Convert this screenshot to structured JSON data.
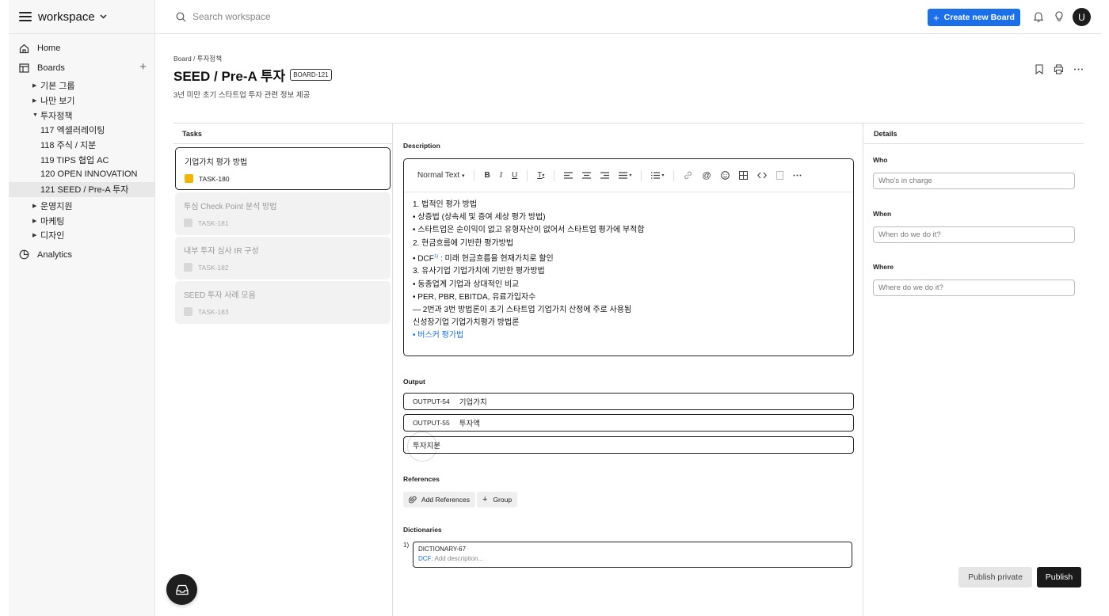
{
  "app": {
    "name": "workspace"
  },
  "topbar": {
    "search_placeholder": "Search workspace",
    "create_button": "Create new Board",
    "create_icon": "+",
    "avatar_initial": "U"
  },
  "sidebar": {
    "home": "Home",
    "boards": "Boards",
    "analytics": "Analytics",
    "tree": [
      {
        "label": "기본 그룹"
      },
      {
        "label": "나만 보기"
      },
      {
        "label": "투자정책"
      },
      {
        "label": "117 엑셀러레이팅"
      },
      {
        "label": "118 주식 / 지분"
      },
      {
        "label": "119 TIPS 협업 AC"
      },
      {
        "label": "120 OPEN INNOVATION"
      },
      {
        "label": "121 SEED / Pre-A 투자"
      },
      {
        "label": "운영지원"
      },
      {
        "label": "마케팅"
      },
      {
        "label": "디자인"
      }
    ]
  },
  "page": {
    "breadcrumb": "Board / 투자정책",
    "title": "SEED / Pre-A 투자",
    "badge": "BOARD-121",
    "subtitle": "3년 미만 초기 스타트업 투자 관련 정보 제공"
  },
  "tasks": {
    "header": "Tasks",
    "items": [
      {
        "name": "기업가치 평가 방법",
        "id": "TASK-180"
      },
      {
        "name": "투심 Check Point 분석 방법",
        "id": "TASK-181"
      },
      {
        "name": "내부 투자 심사 IR 구성",
        "id": "TASK-182"
      },
      {
        "name": "SEED 투자 사례 모음",
        "id": "TASK-183"
      }
    ]
  },
  "description": {
    "label": "Description",
    "text_style": "Normal Text",
    "lines": [
      "1. 법적인 평가 방법",
      "• 상증법 (상속세 및 증여 세상 평가 방법)",
      "• 스타트업은 순이익이 없고 유형자산이 없어서 스타트업 평가에 부적합",
      "2. 현금흐름에 기반한 평가방법",
      "• DCF",
      "1)",
      " : 미래 현금흐름을 현재가치로 할인",
      "3. 유사기업 기업가치에 기반한 평가방법",
      "• 동종업계 기업과 상대적인 비교",
      "• PER, PBR, EBITDA, 유료가입자수",
      "— 2번과 3번 방법론이 초기 스타트업 기업가치 산정에 주로 사용됨",
      "신성장기업 기업가치평가 방법론",
      "• 버스커 평가법"
    ]
  },
  "output": {
    "label": "Output",
    "items": [
      {
        "id": "OUTPUT-54",
        "name": "기업가치"
      },
      {
        "id": "OUTPUT-55",
        "name": "투자액"
      }
    ],
    "new_value": "투자지분"
  },
  "references": {
    "label": "References",
    "add": "Add References",
    "group": "Group"
  },
  "dictionaries": {
    "label": "Dictionaries",
    "num": "1)",
    "id": "DICTIONARY-67",
    "key": "DCF:",
    "placeholder": "Add description..."
  },
  "details": {
    "header": "Details",
    "who": {
      "label": "Who",
      "placeholder": "Who's in charge"
    },
    "when": {
      "label": "When",
      "placeholder": "When do we do it?"
    },
    "where": {
      "label": "Where",
      "placeholder": "Where do we do it?"
    }
  },
  "actions": {
    "publish_private": "Publish private",
    "publish": "Publish"
  },
  "colors": {
    "accent": "#1b6fe8",
    "task_active": "#f4b400",
    "dark": "#1a1a1a"
  }
}
